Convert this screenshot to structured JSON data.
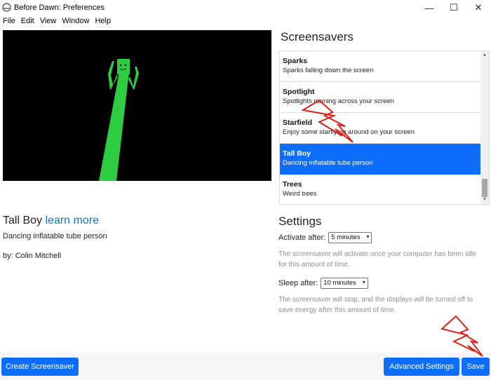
{
  "window": {
    "title": "Before Dawn: Preferences",
    "minimize": "—",
    "maximize": "☐",
    "close": "✕"
  },
  "menu": [
    "File",
    "Edit",
    "View",
    "Window",
    "Help"
  ],
  "screensavers": {
    "heading": "Screensavers",
    "items": [
      {
        "name": "Sparks",
        "desc": "Sparks falling down the screen"
      },
      {
        "name": "Spotlight",
        "desc": "Spotlights running across your screen"
      },
      {
        "name": "Starfield",
        "desc": "Enjoy some starflying around on your screen"
      },
      {
        "name": "Tall Boy",
        "desc": "Dancing inflatable tube person"
      },
      {
        "name": "Trees",
        "desc": "Weird trees"
      }
    ],
    "selected_index": 3
  },
  "details": {
    "title": "Tall Boy",
    "learn_more": "learn more",
    "description": "Dancing inflatable tube person",
    "author": "by: Colin Mitchell"
  },
  "settings": {
    "heading": "Settings",
    "activate_label": "Activate after:",
    "activate_value": "5 minutes",
    "activate_help": "The screensaver will activate once your computer has been idle for this amount of time.",
    "sleep_label": "Sleep after:",
    "sleep_value": "10 minutes",
    "sleep_help": "The screensaver will stop, and the displays will be turned off to save energy after this amount of time."
  },
  "footer": {
    "create": "Create Screensaver",
    "advanced": "Advanced Settings",
    "save": "Save"
  },
  "colors": {
    "accent": "#0d6efd",
    "link": "#1a73c8",
    "preview_bg": "#000000",
    "tube": "#2ecc40",
    "annotation": "#e0201b"
  }
}
